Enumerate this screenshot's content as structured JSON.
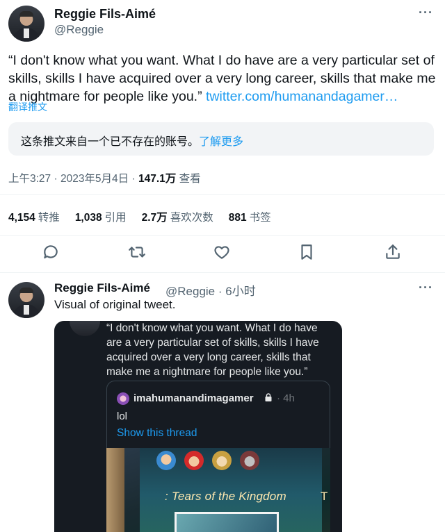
{
  "main_tweet": {
    "author_name": "Reggie Fils-Aimé",
    "author_handle": "@Reggie",
    "more_label": "···",
    "text": "“I don't know what you want. What I do have are a very particular set of skills, skills I have acquired over a very long career, skills that make me a nightmare for people like you.”",
    "link_text": "twitter.com/humanandagamer…",
    "translate_label": "翻译推文",
    "notice_text": "这条推文来自一个已不存在的账号。",
    "notice_link": "了解更多",
    "time": "上午3:27",
    "date": "2023年5月4日",
    "views_count": "147.1万",
    "views_label": "查看",
    "stats": {
      "retweets_count": "4,154",
      "retweets_label": "转推",
      "quotes_count": "1,038",
      "quotes_label": "引用",
      "likes_count": "2.7万",
      "likes_label": "喜欢次数",
      "bookmarks_count": "881",
      "bookmarks_label": "书签"
    },
    "actions": [
      "reply-icon",
      "retweet-icon",
      "like-icon",
      "bookmark-icon",
      "share-icon"
    ]
  },
  "reply": {
    "author_name": "Reggie Fils-Aimé",
    "author_handle": "@Reggie",
    "time_ago": "6小时",
    "more_label": "···",
    "text": "Visual of original tweet.",
    "media": {
      "inner_text": "“I don't know what you want. What I do have are a very particular set of skills, skills I have acquired over a very long career, skills that make me a nightmare for people like you.”",
      "quote": {
        "name": "imahumanandimagamer",
        "time": "4h",
        "body": "lol",
        "show_thread": "Show this thread",
        "photo_title": ": Tears of the Kingdom",
        "photo_title_2": "T"
      }
    }
  },
  "colors": {
    "link": "#1d9bf0",
    "secondary": "#536471",
    "text": "#0f1419",
    "media_bg": "#161b22"
  }
}
